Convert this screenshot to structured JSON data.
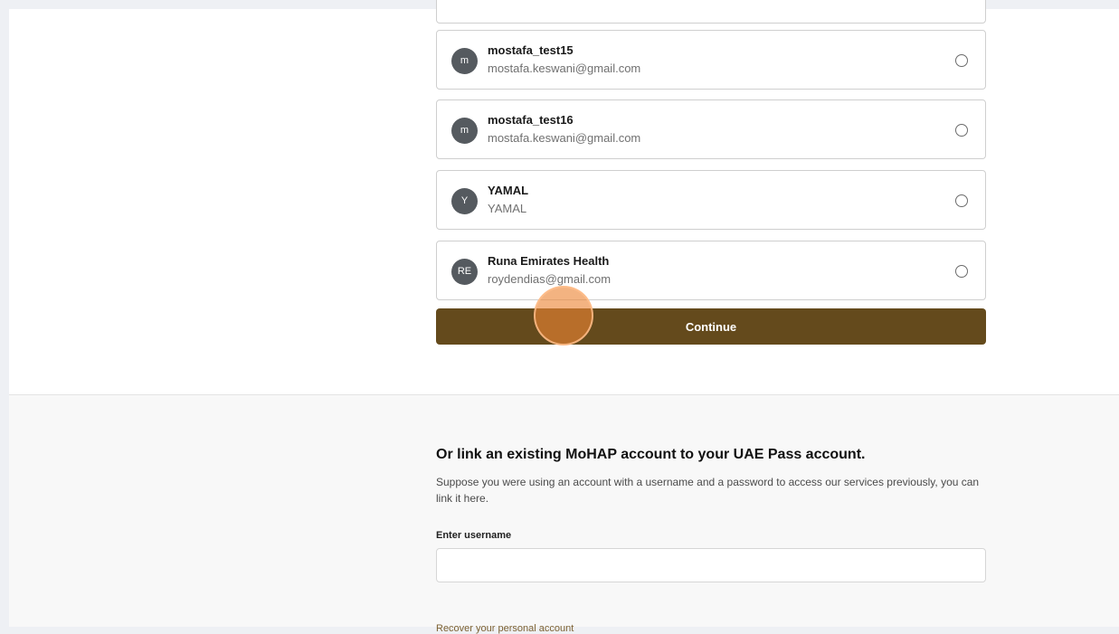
{
  "accounts": [
    {
      "initial": "m",
      "name": "mostafa_test15",
      "email": "mostafa.keswani@gmail.com"
    },
    {
      "initial": "m",
      "name": "mostafa_test16",
      "email": "mostafa.keswani@gmail.com"
    },
    {
      "initial": "Y",
      "name": "YAMAL",
      "email": "YAMAL"
    },
    {
      "initial": "RE",
      "name": "Runa Emirates Health",
      "email": "roydendias@gmail.com"
    }
  ],
  "continue_label": "Continue",
  "link_section": {
    "title": "Or link an existing MoHAP account to your UAE Pass account.",
    "description": "Suppose you were using an account with a username and a password to access our services previously, you can link it here.",
    "username_label": "Enter username",
    "username_value": "",
    "recover_label": "Recover your personal account"
  },
  "colors": {
    "primary": "#644a1c",
    "avatar": "#555a5f",
    "click_indicator": "#ec8434"
  }
}
